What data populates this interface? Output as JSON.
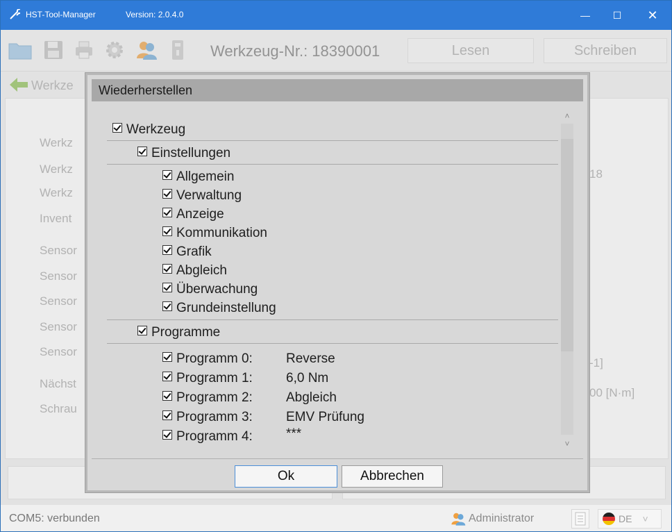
{
  "window": {
    "title": "HST-Tool-Manager",
    "version": "Version: 2.0.4.0",
    "controls": {
      "minimize": "—",
      "maximize": "☐",
      "close": "✕"
    }
  },
  "toolbar": {
    "tool_number": "Werkzeug-Nr.: 18390001",
    "read_label": "Lesen",
    "write_label": "Schreiben"
  },
  "nav": {
    "label": "Werkze"
  },
  "background": {
    "labels": [
      "Werkz",
      "Werkz",
      "Werkz",
      "Invent",
      "Sensor",
      "Sensor",
      "Sensor",
      "Sensor",
      "Sensor",
      "Nächst",
      "Schrau"
    ],
    "right_values": [
      "18",
      "-1]",
      "00 [N·m]"
    ]
  },
  "dialog": {
    "title": "Wiederherstellen",
    "root_label": "Werkzeug",
    "settings_label": "Einstellungen",
    "settings_items": [
      "Allgemein",
      "Verwaltung",
      "Anzeige",
      "Kommunikation",
      "Grafik",
      "Abgleich",
      "Überwachung",
      "Grundeinstellung"
    ],
    "programs_label": "Programme",
    "programs": [
      {
        "label": "Programm 0:",
        "name": "Reverse"
      },
      {
        "label": "Programm 1:",
        "name": "6,0 Nm"
      },
      {
        "label": "Programm 2:",
        "name": "Abgleich"
      },
      {
        "label": "Programm 3:",
        "name": "EMV Prüfung"
      },
      {
        "label": "Programm 4:",
        "name": "***"
      }
    ],
    "ok_label": "Ok",
    "cancel_label": "Abbrechen",
    "scroll_up": "˄",
    "scroll_down": "˅"
  },
  "status": {
    "connection": "COM5: verbunden",
    "user": "Administrator",
    "language": "DE",
    "language_caret": "˅"
  },
  "colors": {
    "titlebar": "#2f7bd8",
    "dialog_bg": "#d8d8d8",
    "dialog_title_bg": "#a8a8a8",
    "ok_border": "#4a8ed8"
  }
}
